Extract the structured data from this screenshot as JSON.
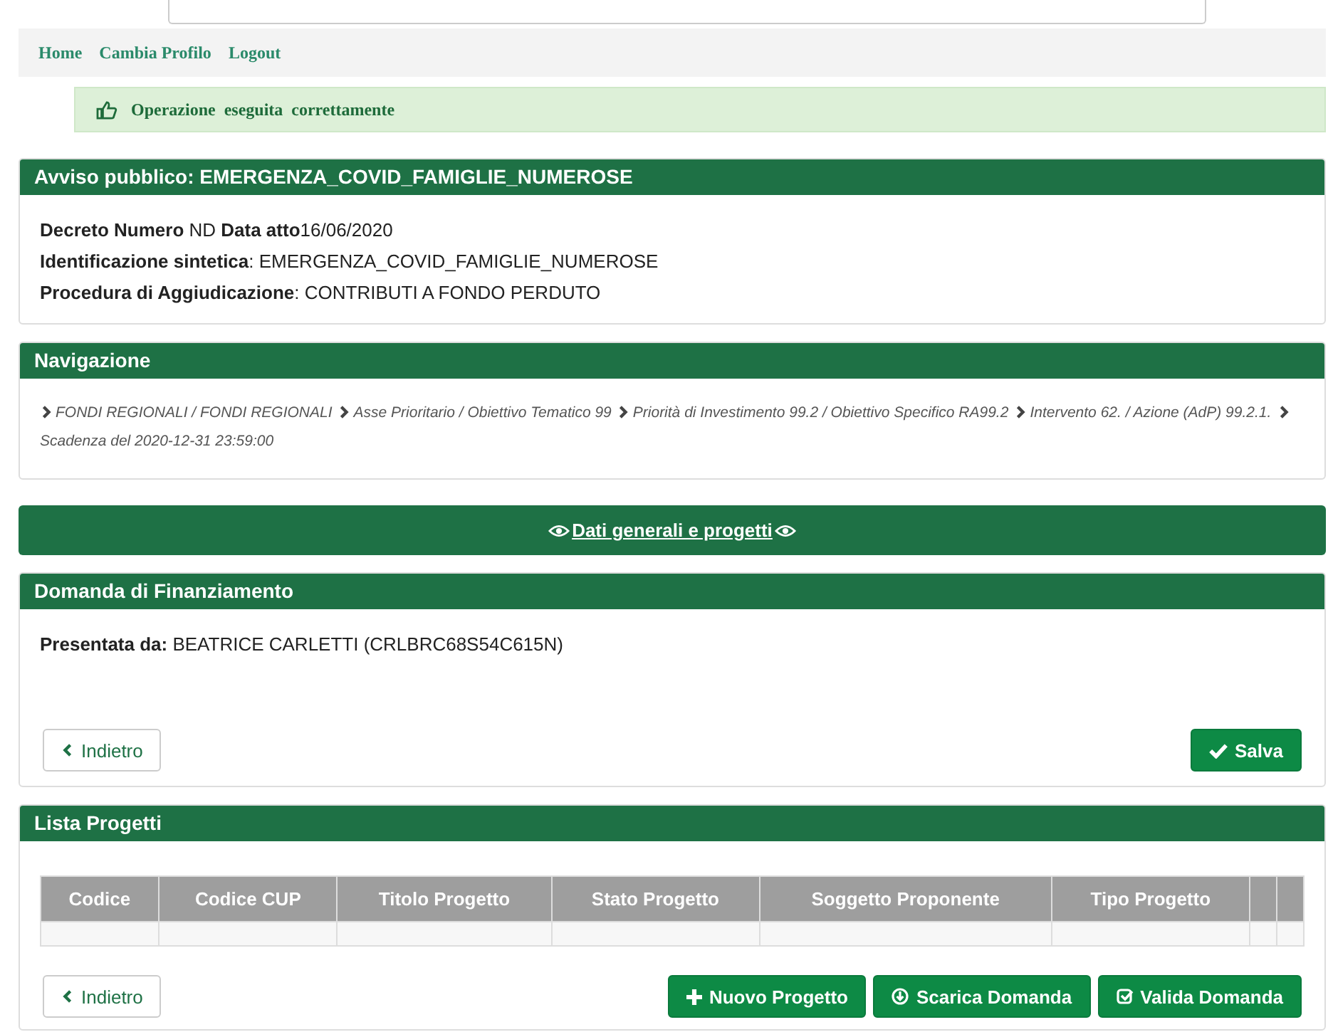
{
  "nav": {
    "links": [
      "Home",
      "Cambia Profilo",
      "Logout"
    ]
  },
  "alert": {
    "message": "Operazione  eseguita  correttamente"
  },
  "avviso": {
    "title": "Avviso pubblico: EMERGENZA_COVID_FAMIGLIE_NUMEROSE",
    "lines": [
      "**Decreto Numero** ND **Data atto**16/06/2020",
      "**Identificazione sintetica**: EMERGENZA_COVID_FAMIGLIE_NUMEROSE",
      "**Procedura di Aggiudicazione**: CONTRIBUTI A FONDO PERDUTO"
    ]
  },
  "navigazione": {
    "title": "Navigazione",
    "breadcrumb": [
      "FONDI REGIONALI / FONDI REGIONALI",
      "Asse Prioritario / Obiettivo Tematico 99",
      "Priorità di Investimento 99.2 / Obiettivo Specifico RA99.2",
      "Intervento 62. / Azione (AdP) 99.2.1.",
      "Scadenza del 2020-12-31 23:59:00"
    ]
  },
  "dati_generali": {
    "label": "Dati generali e progetti "
  },
  "domanda": {
    "title": "Domanda di Finanziamento",
    "presentata": "**Presentata da:** BEATRICE CARLETTI (CRLBRC68S54C615N)",
    "buttons": [
      {
        "label": "Indietro",
        "kind": "back"
      },
      {
        "label": "Salva",
        "kind": "save"
      }
    ]
  },
  "lista_progetti": {
    "title": "Lista Progetti",
    "columns": [
      "Codice",
      "Codice CUP",
      "Titolo Progetto",
      "Stato Progetto",
      "Soggetto Proponente",
      "Tipo Progetto"
    ],
    "buttons": [
      {
        "label": "Indietro",
        "kind": "back"
      },
      {
        "label": "Nuovo Progetto",
        "kind": "new"
      },
      {
        "label": "Scarica Domanda",
        "kind": "download"
      },
      {
        "label": "Valida Domanda",
        "kind": "validate"
      }
    ]
  }
}
